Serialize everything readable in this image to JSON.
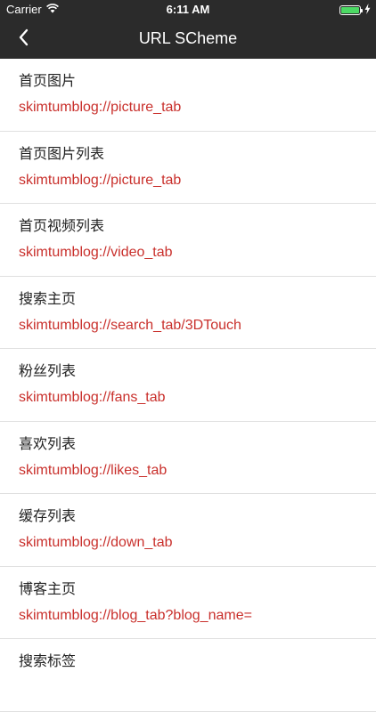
{
  "status_bar": {
    "carrier": "Carrier",
    "time": "6:11 AM"
  },
  "nav": {
    "title": "URL SCheme",
    "back_icon": "chevron-left-icon"
  },
  "items": [
    {
      "name": "首页图片",
      "scheme": "skimtumblog://picture_tab"
    },
    {
      "name": "首页图片列表",
      "scheme": "skimtumblog://picture_tab"
    },
    {
      "name": "首页视频列表",
      "scheme": "skimtumblog://video_tab"
    },
    {
      "name": "搜索主页",
      "scheme": "skimtumblog://search_tab/3DTouch"
    },
    {
      "name": "粉丝列表",
      "scheme": "skimtumblog://fans_tab"
    },
    {
      "name": "喜欢列表",
      "scheme": "skimtumblog://likes_tab"
    },
    {
      "name": "缓存列表",
      "scheme": "skimtumblog://down_tab"
    },
    {
      "name": "博客主页",
      "scheme": "skimtumblog://blog_tab?blog_name="
    },
    {
      "name": "搜索标签",
      "scheme": ""
    }
  ],
  "colors": {
    "nav_background": "#2b2b2b",
    "scheme_text": "#c9302c",
    "battery": "#4cd964"
  }
}
